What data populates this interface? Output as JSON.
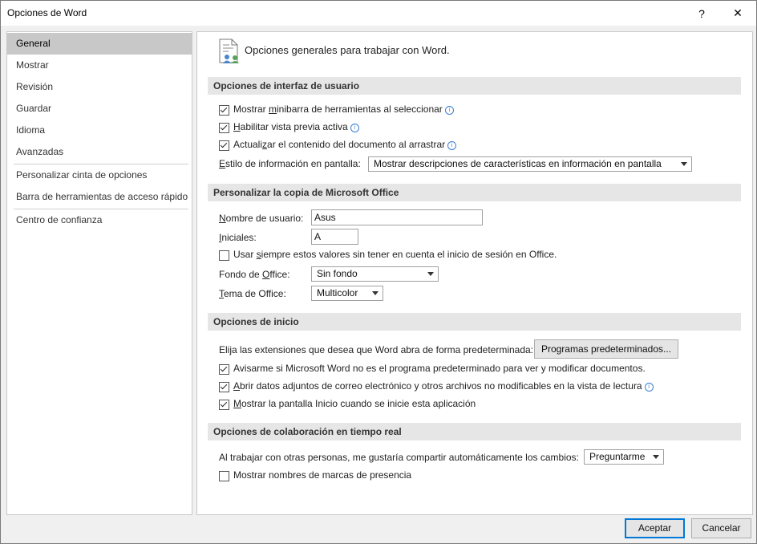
{
  "window": {
    "title": "Opciones de Word",
    "help_glyph": "?",
    "close_glyph": "✕"
  },
  "sidebar": {
    "items": [
      {
        "label": "General",
        "selected": true
      },
      {
        "label": "Mostrar"
      },
      {
        "label": "Revisión"
      },
      {
        "label": "Guardar"
      },
      {
        "label": "Idioma"
      },
      {
        "label": "Avanzadas"
      },
      {
        "label": "Personalizar cinta de opciones"
      },
      {
        "label": "Barra de herramientas de acceso rápido"
      },
      {
        "label": "Centro de confianza"
      }
    ]
  },
  "main": {
    "header": "Opciones generales para trabajar con Word.",
    "ui_section": {
      "title": "Opciones de interfaz de usuario",
      "minibar": {
        "pre": "Mostrar ",
        "key": "m",
        "post": "inibarra de herramientas al seleccionar",
        "checked": true
      },
      "preview": {
        "key": "H",
        "post": "abilitar vista previa activa",
        "checked": true
      },
      "update": {
        "pre": "Actuali",
        "key": "z",
        "post": "ar el contenido del documento al arrastrar",
        "checked": true
      },
      "screentip_label_key": "E",
      "screentip_label_rest": "stilo de información en pantalla:",
      "screentip_value": "Mostrar descripciones de características en información en pantalla"
    },
    "office_section": {
      "title": "Personalizar la copia de Microsoft Office",
      "username_label_key": "N",
      "username_label_rest": "ombre de usuario:",
      "username_value": "Asus",
      "initials_label_key": "I",
      "initials_label_rest": "niciales:",
      "initials_value": "A",
      "always_use": {
        "pre": "Usar ",
        "key": "s",
        "post": "iempre estos valores sin tener en cuenta el inicio de sesión en Office.",
        "checked": false
      },
      "background_label_pre": "Fondo de ",
      "background_label_key": "O",
      "background_label_post": "ffice:",
      "background_value": "Sin fondo",
      "theme_label_key": "T",
      "theme_label_rest": "ema de Office:",
      "theme_value": "Multicolor"
    },
    "startup_section": {
      "title": "Opciones de inicio",
      "extensions_text": "Elija las extensiones que desea que Word abra de forma predeterminada:",
      "default_programs_button": "Programas predeterminados...",
      "notify": {
        "pre": "Avisarme si Microsoft Word no es el programa predeterminado para ver y modificar documentos.",
        "checked": true
      },
      "attachments": {
        "key": "A",
        "post": "brir datos adjuntos de correo electrónico y otros archivos no modificables en la vista de lectura",
        "checked": true
      },
      "start_screen": {
        "key": "M",
        "post": "ostrar la pantalla Inicio cuando se inicie esta aplicación",
        "checked": true
      }
    },
    "collab_section": {
      "title": "Opciones de colaboración en tiempo real",
      "share_text": "Al trabajar con otras personas, me gustaría compartir automáticamente los cambios:",
      "share_value": "Preguntarme",
      "presence_flags": {
        "pre": "Mostrar nombres de marcas de presencia",
        "checked": false
      }
    }
  },
  "footer": {
    "ok_label": "Aceptar",
    "cancel_label": "Cancelar"
  }
}
